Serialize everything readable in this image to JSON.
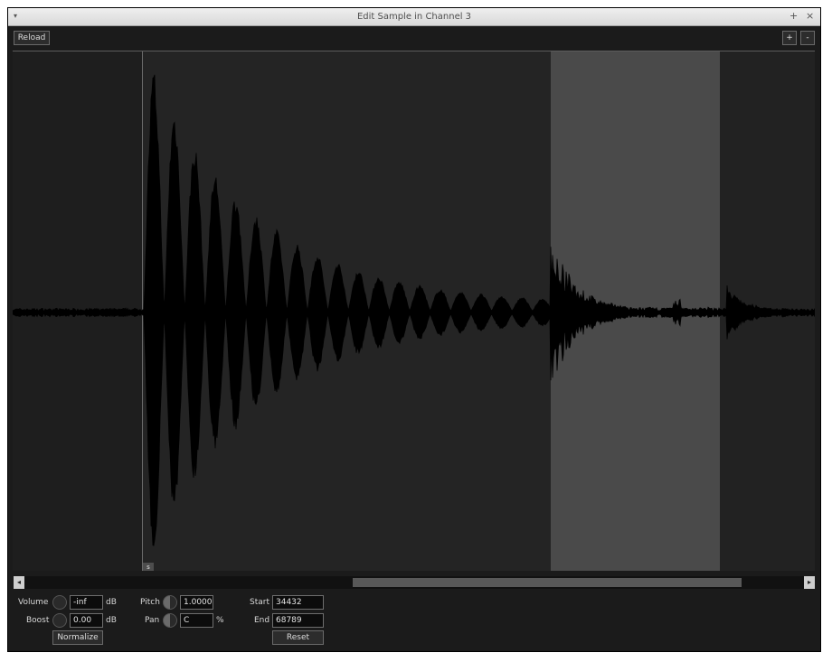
{
  "window": {
    "title": "Edit Sample in Channel 3"
  },
  "toolbar": {
    "reload_label": "Reload",
    "zoom_in_label": "+",
    "zoom_out_label": "-"
  },
  "titlebar": {
    "menu_glyph": "▾",
    "pin_glyph": "+",
    "close_glyph": "×"
  },
  "waveform": {
    "marker_label": "s",
    "colors": {
      "background": "#1e1e1e",
      "left_region": "#242424",
      "selection": "#4a4a4a",
      "wave": "#000000",
      "line": "#5c5c5c"
    }
  },
  "scrollbar": {
    "left_arrow": "◂",
    "right_arrow": "▸"
  },
  "controls": {
    "volume": {
      "label": "Volume",
      "value": "-inf",
      "unit": "dB"
    },
    "boost": {
      "label": "Boost",
      "value": "0.00",
      "unit": "dB"
    },
    "normalize_label": "Normalize",
    "pitch": {
      "label": "Pitch",
      "value": "1.0000"
    },
    "pan": {
      "label": "Pan",
      "value": "C",
      "unit": "%"
    },
    "start": {
      "label": "Start",
      "value": "34432"
    },
    "end": {
      "label": "End",
      "value": "68789"
    },
    "reset_label": "Reset"
  }
}
